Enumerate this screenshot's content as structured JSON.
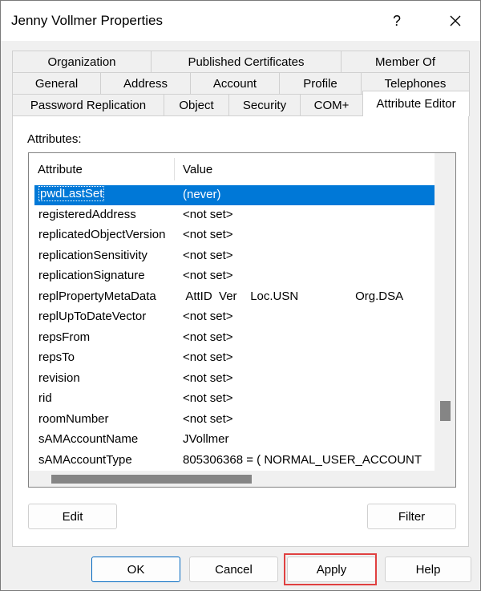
{
  "window": {
    "title": "Jenny Vollmer Properties",
    "help_label": "?",
    "close_icon": "close-icon"
  },
  "tabs": {
    "row1": [
      "Organization",
      "Published Certificates",
      "Member Of"
    ],
    "row2": [
      "General",
      "Address",
      "Account",
      "Profile",
      "Telephones"
    ],
    "row3": [
      "Password Replication",
      "Object",
      "Security",
      "COM+",
      "Attribute Editor"
    ],
    "active": "Attribute Editor"
  },
  "attribute_editor": {
    "label": "Attributes:",
    "columns": [
      "Attribute",
      "Value"
    ],
    "rows": [
      {
        "attribute": "pwdLastSet",
        "value": "(never)",
        "selected": true
      },
      {
        "attribute": "registeredAddress",
        "value": "<not set>"
      },
      {
        "attribute": "replicatedObjectVersion",
        "value": "<not set>"
      },
      {
        "attribute": "replicationSensitivity",
        "value": "<not set>"
      },
      {
        "attribute": "replicationSignature",
        "value": "<not set>"
      },
      {
        "attribute": "replPropertyMetaData",
        "value": " AttID  Ver    Loc.USN                 Org.DSA"
      },
      {
        "attribute": "replUpToDateVector",
        "value": "<not set>"
      },
      {
        "attribute": "repsFrom",
        "value": "<not set>"
      },
      {
        "attribute": "repsTo",
        "value": "<not set>"
      },
      {
        "attribute": "revision",
        "value": "<not set>"
      },
      {
        "attribute": "rid",
        "value": "<not set>"
      },
      {
        "attribute": "roomNumber",
        "value": "<not set>"
      },
      {
        "attribute": "sAMAccountName",
        "value": "JVollmer"
      },
      {
        "attribute": "sAMAccountType",
        "value": "805306368 = ( NORMAL_USER_ACCOUNT"
      }
    ],
    "edit_label": "Edit",
    "filter_label": "Filter"
  },
  "footer": {
    "ok_label": "OK",
    "cancel_label": "Cancel",
    "apply_label": "Apply",
    "help_label": "Help"
  },
  "colors": {
    "selection": "#0078d7",
    "highlight": "#e04040"
  }
}
